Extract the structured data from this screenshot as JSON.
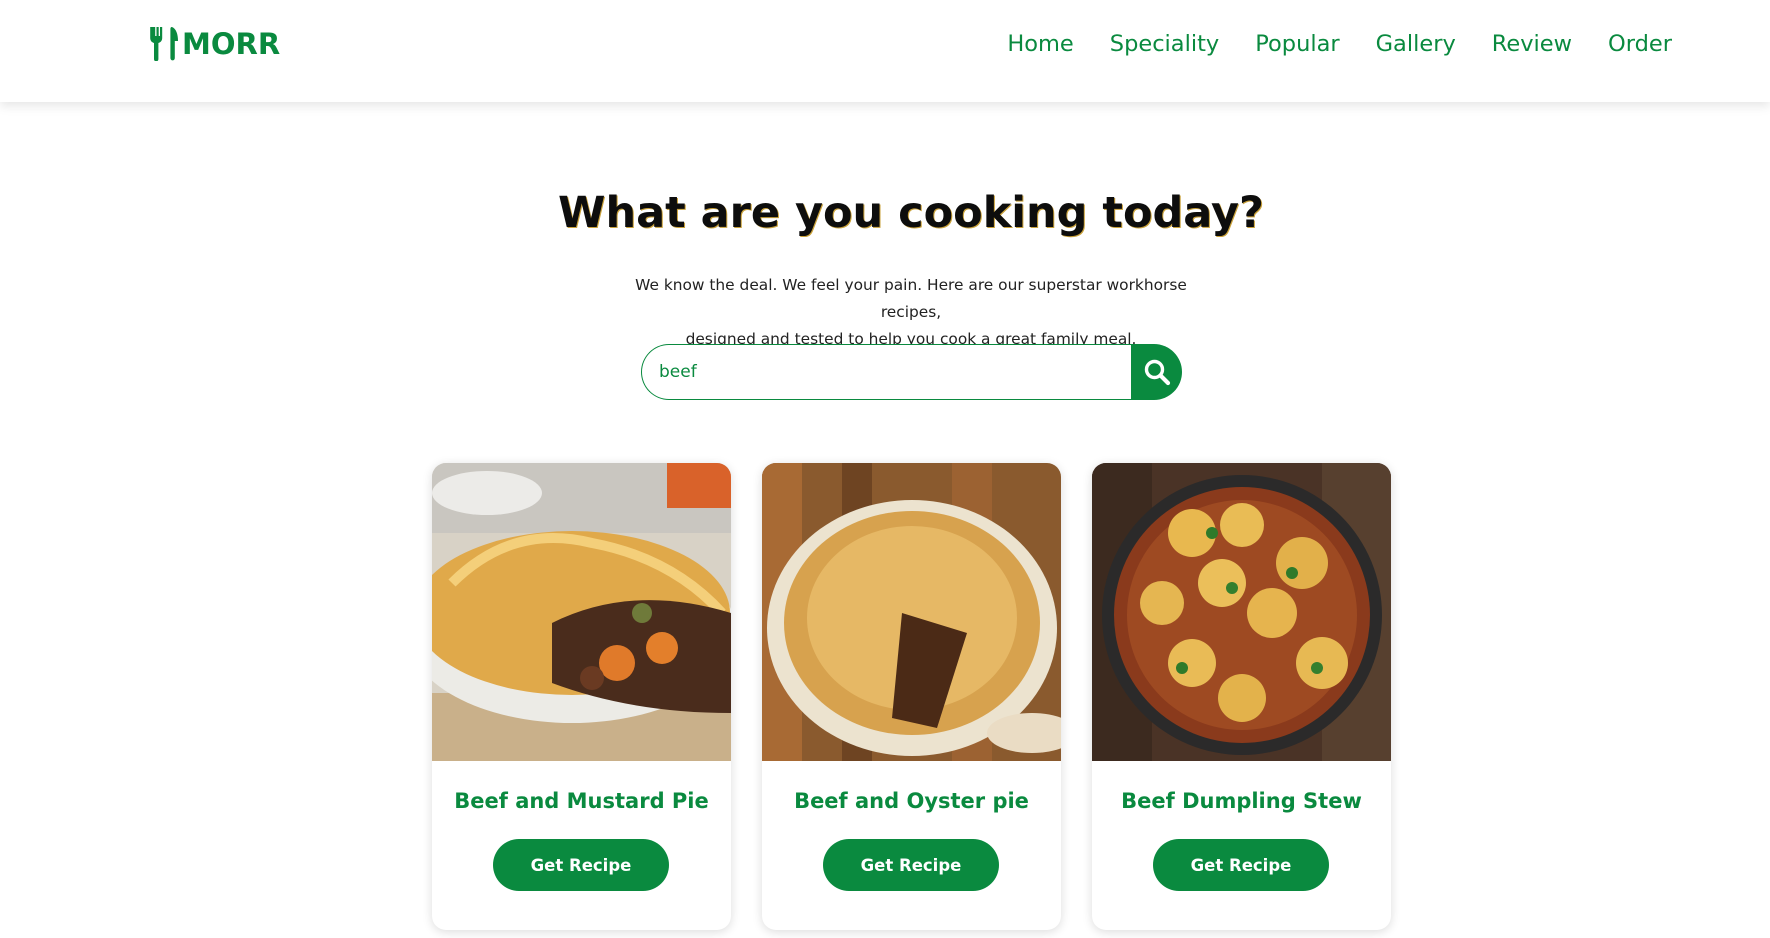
{
  "header": {
    "logo_text": "MORR",
    "logo_icon": "fork-knife-icon",
    "nav": [
      "Home",
      "Speciality",
      "Popular",
      "Gallery",
      "Review",
      "Order"
    ]
  },
  "hero": {
    "title": "What are you cooking today?",
    "subtitle_line1": "We know the deal. We feel your pain. Here are our superstar workhorse recipes,",
    "subtitle_line2": "designed and tested to help you cook a great family meal."
  },
  "search": {
    "value": "beef",
    "icon": "search-icon"
  },
  "recipes": [
    {
      "title": "Beef and Mustard Pie",
      "button": "Get Recipe",
      "image": "beef-mustard-pie-photo"
    },
    {
      "title": "Beef and Oyster pie",
      "button": "Get Recipe",
      "image": "beef-oyster-pie-photo"
    },
    {
      "title": "Beef Dumpling Stew",
      "button": "Get Recipe",
      "image": "beef-dumpling-stew-photo"
    }
  ],
  "colors": {
    "brand": "#0a8a3f",
    "text": "#0d0d0d",
    "background": "#ffffff"
  }
}
